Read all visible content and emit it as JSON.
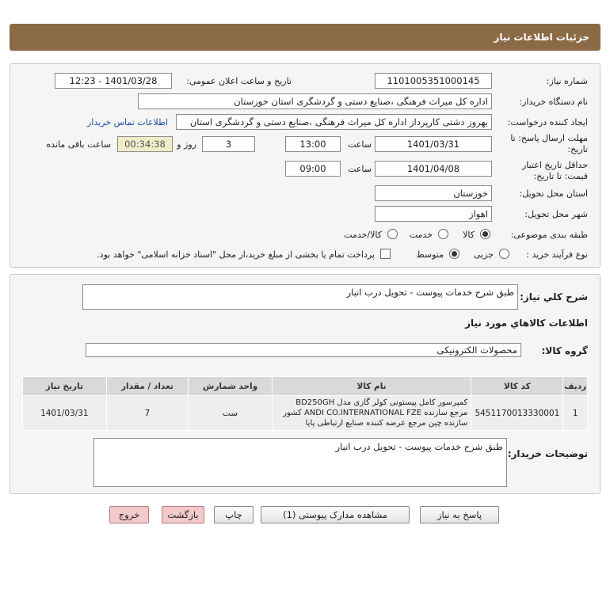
{
  "header": {
    "title": "جزئیات اطلاعات نیاز"
  },
  "form": {
    "need_number_label": "شماره نیاز:",
    "need_number": "1101005351000145",
    "announce_label": "تاریخ و ساعت اعلان عمومی:",
    "announce_value": "1401/03/28 - 12:23",
    "buyer_org_label": "نام دستگاه خریدار:",
    "buyer_org": "اداره کل میراث فرهنگی ،صنایع دستی و گردشگری استان خوزستان",
    "requester_label": "ایجاد کننده درخواست:",
    "requester": "بهروز دشتی کارپرداز اداره کل میراث فرهنگی ،صنایع دستی و گردشگری استان",
    "contact_link": "اطلاعات تماس خریدار",
    "deadline_label_1": "مهلت ارسال پاسخ: تا",
    "deadline_label_2": "تاریخ:",
    "deadline_date": "1401/03/31",
    "time_label": "ساعت",
    "deadline_time": "13:00",
    "days_value": "3",
    "days_label": "روز و",
    "remaining_value": "00:34:38",
    "remaining_label": "ساعت باقی مانده",
    "validity_label_1": "حداقل تاریخ اعتبار",
    "validity_label_2": "قیمت: تا تاریخ:",
    "validity_date": "1401/04/08",
    "validity_time_label": "ساعت",
    "validity_time": "09:00",
    "province_label": "استان محل تحویل:",
    "province": "خوزستان",
    "city_label": "شهر محل تحویل:",
    "city": "اهواز",
    "category_label": "طبقه بندی موضوعی:",
    "category_options": [
      "کالا",
      "خدمت",
      "کالا/خدمت"
    ],
    "category_selected": "کالا",
    "process_label": "نوع فرآیند خرید :",
    "process_options": [
      "جزیی",
      "متوسط"
    ],
    "process_selected": "متوسط",
    "payment_note": "پرداخت تمام یا بخشی از مبلغ خرید،از محل \"اسناد خزانه اسلامی\" خواهد بود."
  },
  "summary": {
    "label": "شرح کلي نياز:",
    "value": "طبق شرح خدمات پیوست - تحویل درب انبار"
  },
  "goods": {
    "section_title": "اطلاعات کالاهاي مورد نياز",
    "group_label": "گروه کالا:",
    "group_value": "محصولات الکترونیکی",
    "columns": [
      "ردیف",
      "کد کالا",
      "نام کالا",
      "واحد شمارش",
      "تعداد / مقدار",
      "تاریخ نیاز"
    ],
    "rows": [
      {
        "row": "1",
        "code": "5451170013330001",
        "name": "کمپرسور کامل پیستونی کولر گازی مدل BD250GH مرجع سازنده ANDI CO.INTERNATIONAL FZE کشور سازنده چین مرجع عرضه کننده صنایع ارتباطی پایا",
        "unit": "ست",
        "qty": "7",
        "date": "1401/03/31"
      }
    ]
  },
  "buyer_notes": {
    "label": "توضیحات خریدار:",
    "value": "طبق شرح خدمات پیوست - تحویل درب انبار"
  },
  "buttons": {
    "reply": "پاسخ به نیاز",
    "attachments": "مشاهده مدارک پیوستی (1)",
    "print": "چاپ",
    "back": "بازگشت",
    "exit": "خروج"
  }
}
